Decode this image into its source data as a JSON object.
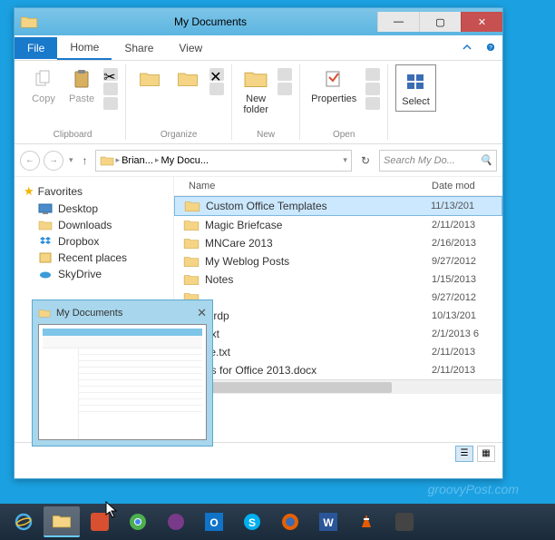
{
  "window": {
    "title": "My Documents"
  },
  "tabs": {
    "file": "File",
    "items": [
      "Home",
      "Share",
      "View"
    ]
  },
  "ribbon": {
    "clipboard": {
      "label": "Clipboard",
      "copy": "Copy",
      "paste": "Paste"
    },
    "organize": {
      "label": "Organize"
    },
    "new": {
      "label": "New",
      "newfolder": "New\nfolder"
    },
    "open": {
      "label": "Open",
      "properties": "Properties"
    },
    "select": {
      "label": "Select",
      "btn": "Select"
    }
  },
  "breadcrumb": {
    "parts": [
      "Brian...",
      "My Docu..."
    ]
  },
  "search": {
    "placeholder": "Search My Do..."
  },
  "sidebar": {
    "favorites": "Favorites",
    "items": [
      {
        "label": "Desktop",
        "icon": "desktop"
      },
      {
        "label": "Downloads",
        "icon": "downloads"
      },
      {
        "label": "Dropbox",
        "icon": "dropbox"
      },
      {
        "label": "Recent places",
        "icon": "recent"
      },
      {
        "label": "SkyDrive",
        "icon": "skydrive"
      }
    ]
  },
  "columns": {
    "name": "Name",
    "date": "Date mod"
  },
  "files": [
    {
      "name": "Custom Office Templates",
      "date": "11/13/201",
      "type": "folder",
      "selected": true
    },
    {
      "name": "Magic Briefcase",
      "date": "2/11/2013",
      "type": "folder"
    },
    {
      "name": "MNCare 2013",
      "date": "2/16/2013",
      "type": "folder"
    },
    {
      "name": "My Weblog Posts",
      "date": "9/27/2012",
      "type": "folder"
    },
    {
      "name": "Notes",
      "date": "1/15/2013",
      "type": "folder"
    },
    {
      "name": "",
      "date": "9/27/2012",
      "type": "folder"
    },
    {
      "name": "lt.rdp",
      "date": "10/13/201",
      "type": "file"
    },
    {
      "name": ".txt",
      "date": "2/1/2013 6",
      "type": "file"
    },
    {
      "name": "ile.txt",
      "date": "2/11/2013",
      "type": "file"
    },
    {
      "name": "es for Office 2013.docx",
      "date": "2/11/2013",
      "type": "file"
    }
  ],
  "thumbnail": {
    "title": "My Documents"
  },
  "watermark": "groovyPost.com"
}
